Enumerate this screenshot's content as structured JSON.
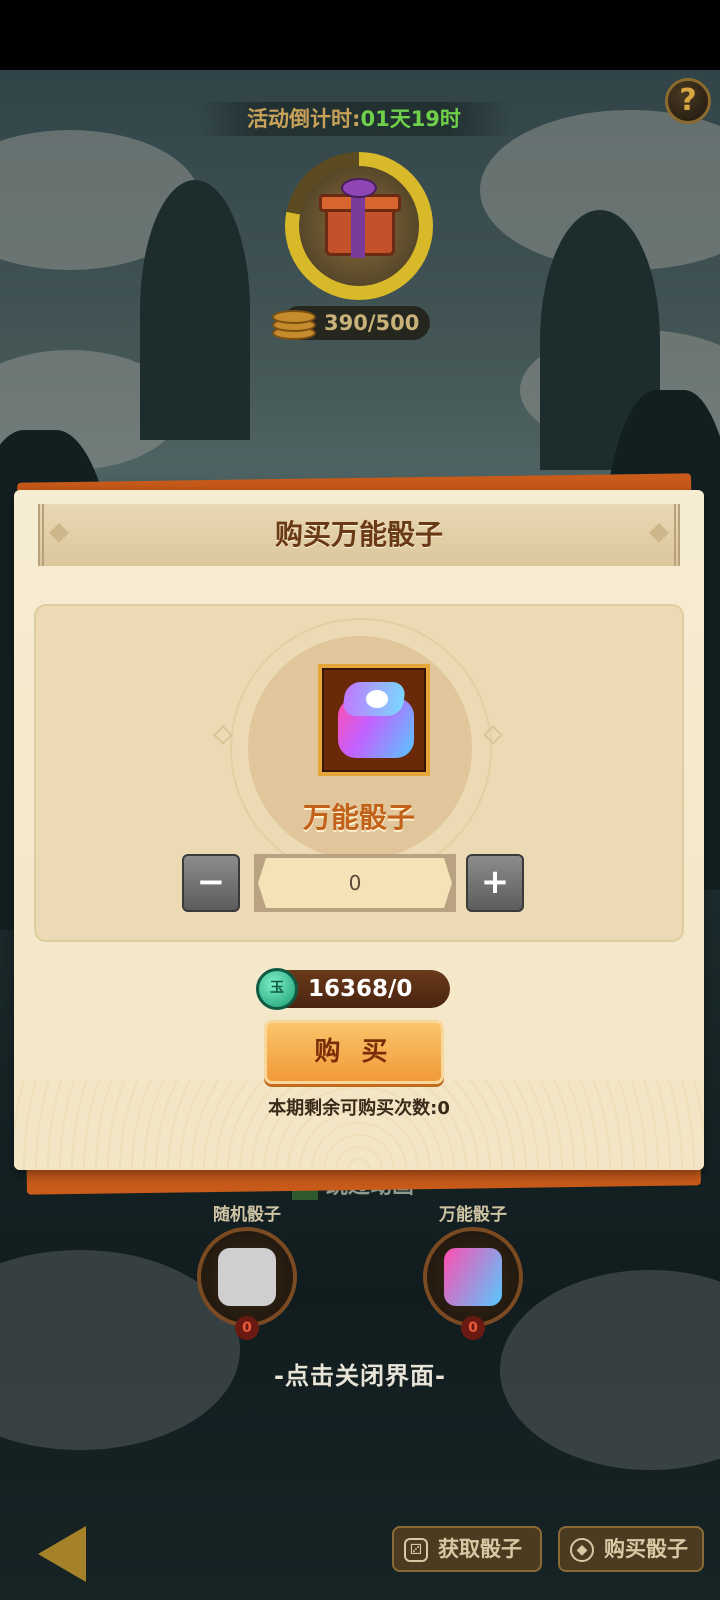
{
  "event": {
    "countdown_label": "活动倒计时:",
    "countdown_time": "01天19时",
    "progress": {
      "current": 390,
      "max": 500,
      "text": "390/500"
    }
  },
  "help_button": {
    "label": "?"
  },
  "modal": {
    "title": "购买万能骰子",
    "item_name": "万能骰子",
    "quantity": "0",
    "minus_label": "−",
    "plus_label": "+",
    "price_text": "16368/0",
    "currency_icon_label": "玉",
    "buy_label": "购 买",
    "remaining_text": "本期剩余可购买次数:0"
  },
  "background_ui": {
    "skip_animation": "跳过动画",
    "random_dice": {
      "label": "随机骰子",
      "count": "0"
    },
    "universal_dice": {
      "label": "万能骰子",
      "count": "0"
    },
    "close_hint": "-点击关闭界面-",
    "get_dice_button": "获取骰子",
    "buy_dice_button": "购买骰子"
  },
  "colors": {
    "accent_orange": "#f19a3a",
    "title_brown": "#6a3a14",
    "countdown_green": "#6fd14a",
    "modal_background": "#f3e6c6"
  }
}
